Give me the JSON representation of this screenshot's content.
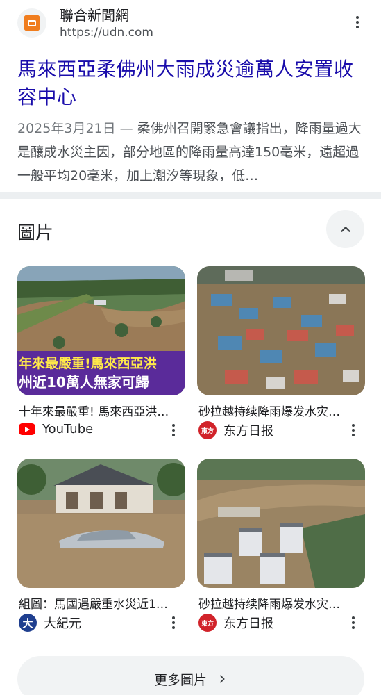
{
  "result": {
    "site_name": "聯合新聞網",
    "site_url": "https://udn.com",
    "title": "馬來西亞柔佛州大雨成災逾萬人安置收容中心",
    "date": "2025年3月21日",
    "separator": " — ",
    "snippet": "柔佛州召開緊急會議指出，降雨量過大是釀成水災主因，部分地區的降雨量高達150毫米，遠超過一般平均20毫米，加上潮汐等現象，低…"
  },
  "images_section": {
    "title": "圖片",
    "tiles": [
      {
        "caption": "十年來最嚴重! 馬來西亞洪…",
        "source": "YouTube",
        "overlay_line1": "年來最嚴重!馬來西亞洪",
        "overlay_line2": "州近10萬人無家可歸"
      },
      {
        "caption": "砂拉越持续降雨爆发水灾…",
        "source": "东方日报",
        "logo_text": "東方"
      },
      {
        "caption": "組圖：馬國遇嚴重水災近1…",
        "source": "大紀元",
        "logo_text": "大"
      },
      {
        "caption": "砂拉越持续降雨爆发水灾…",
        "source": "东方日报",
        "logo_text": "東方"
      }
    ],
    "more_label": "更多圖片",
    "more_icon": "chevron-right-icon"
  },
  "colors": {
    "link": "#1a0dab",
    "youtube": "#ff0000"
  }
}
